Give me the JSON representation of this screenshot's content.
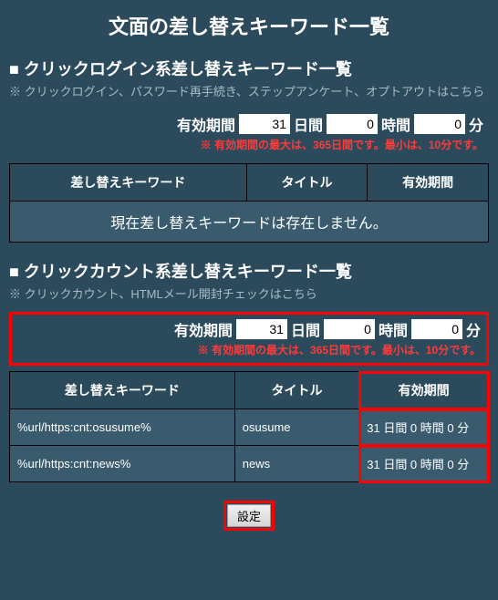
{
  "page_title": "文面の差し替えキーワード一覧",
  "section1": {
    "title": "■ クリックログイン系差し替えキーワード一覧",
    "note": "※ クリックログイン、パスワード再手続き、ステップアンケート、オプトアウトはこちら",
    "validity": {
      "label": "有効期間",
      "days": "31",
      "days_unit": "日間",
      "hours": "0",
      "hours_unit": "時間",
      "minutes": "0",
      "minutes_unit": "分",
      "caption": "※ 有効期間の最大は、365日間です。最小は、10分です。"
    },
    "headers": [
      "差し替えキーワード",
      "タイトル",
      "有効期間"
    ],
    "empty_message": "現在差し替えキーワードは存在しません。"
  },
  "section2": {
    "title": "■ クリックカウント系差し替えキーワード一覧",
    "note": "※ クリックカウント、HTMLメール開封チェックはこちら",
    "validity": {
      "label": "有効期間",
      "days": "31",
      "days_unit": "日間",
      "hours": "0",
      "hours_unit": "時間",
      "minutes": "0",
      "minutes_unit": "分",
      "caption": "※ 有効期間の最大は、365日間です。最小は、10分です。"
    },
    "headers": [
      "差し替えキーワード",
      "タイトル",
      "有効期間"
    ],
    "rows": [
      {
        "keyword": "%url/https:cnt:osusume%",
        "title": "osusume",
        "validity": "31 日間 0 時間 0 分"
      },
      {
        "keyword": "%url/https:cnt:news%",
        "title": "news",
        "validity": "31 日間 0 時間 0 分"
      }
    ]
  },
  "settings_button": "設定"
}
